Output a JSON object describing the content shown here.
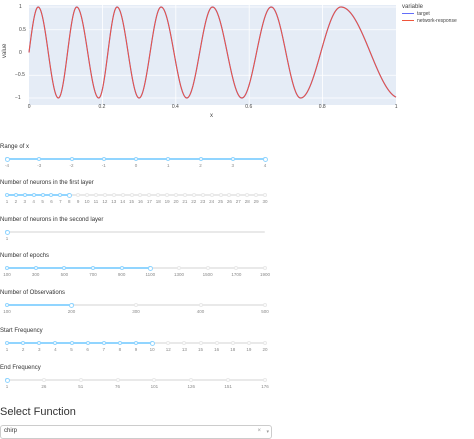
{
  "graph": {
    "y_axis_title": "value",
    "x_axis_title": "x",
    "y_ticks": [
      "1",
      "0.5",
      "0",
      "−0.5",
      "−1"
    ],
    "x_ticks": [
      "0",
      "0.2",
      "0.4",
      "0.6",
      "0.8",
      "1"
    ],
    "legend_title": "variable",
    "legend": [
      {
        "label": "target",
        "color": "#636efa"
      },
      {
        "label": "network-response",
        "color": "#ef553b"
      }
    ]
  },
  "chart_data": {
    "type": "line",
    "function": "chirp",
    "xlim": [
      0,
      1
    ],
    "ylim": [
      -1,
      1
    ],
    "series": [
      {
        "name": "target",
        "color": "#636efa"
      },
      {
        "name": "network-response",
        "color": "#ef553b"
      }
    ],
    "peaks_x": [
      0.025,
      0.13,
      0.24,
      0.36,
      0.5,
      0.66,
      0.85
    ],
    "troughs_x": [
      0.08,
      0.19,
      0.3,
      0.43,
      0.58,
      0.74
    ]
  },
  "sliders": [
    {
      "label": "Range of x",
      "marks": [
        "-4",
        "-3",
        "-2",
        "-1",
        "0",
        "1",
        "2",
        "3",
        "4"
      ],
      "range_min": 0.0,
      "range_max": 1.0,
      "handles": 2
    },
    {
      "label": "Number of neurons in the first layer",
      "marks": [
        "1",
        "2",
        "3",
        "4",
        "5",
        "6",
        "7",
        "8",
        "9",
        "10",
        "11",
        "12",
        "13",
        "14",
        "15",
        "16",
        "17",
        "18",
        "19",
        "20",
        "21",
        "22",
        "23",
        "24",
        "25",
        "26",
        "27",
        "28",
        "29",
        "30"
      ],
      "value_index": 7,
      "handles": 1
    },
    {
      "label": "Number of neurons in the second layer",
      "marks": [
        "1"
      ],
      "value_index": 0,
      "handles": 1
    },
    {
      "label": "Number of epochs",
      "marks": [
        "100",
        "300",
        "500",
        "700",
        "900",
        "1100",
        "1300",
        "1500",
        "1700",
        "1900"
      ],
      "value_index": 5,
      "handles": 1
    },
    {
      "label": "Number of Observations",
      "marks": [
        "100",
        "200",
        "300",
        "400",
        "500"
      ],
      "value_index": 1,
      "handles": 1
    },
    {
      "label": "Start Frequency",
      "marks": [
        "1",
        "2",
        "3",
        "4",
        "5",
        "6",
        "7",
        "8",
        "9",
        "10",
        "12",
        "13",
        "15",
        "16",
        "18",
        "19",
        "20"
      ],
      "value_index": 9,
      "handles": 1
    },
    {
      "label": "End Frequency",
      "marks": [
        "1",
        "26",
        "51",
        "76",
        "101",
        "126",
        "151",
        "176"
      ],
      "value_index": 0,
      "handles": 1
    }
  ],
  "select_function": {
    "title": "Select Function",
    "value": "chirp",
    "clear": "×",
    "arrow": "▾"
  }
}
